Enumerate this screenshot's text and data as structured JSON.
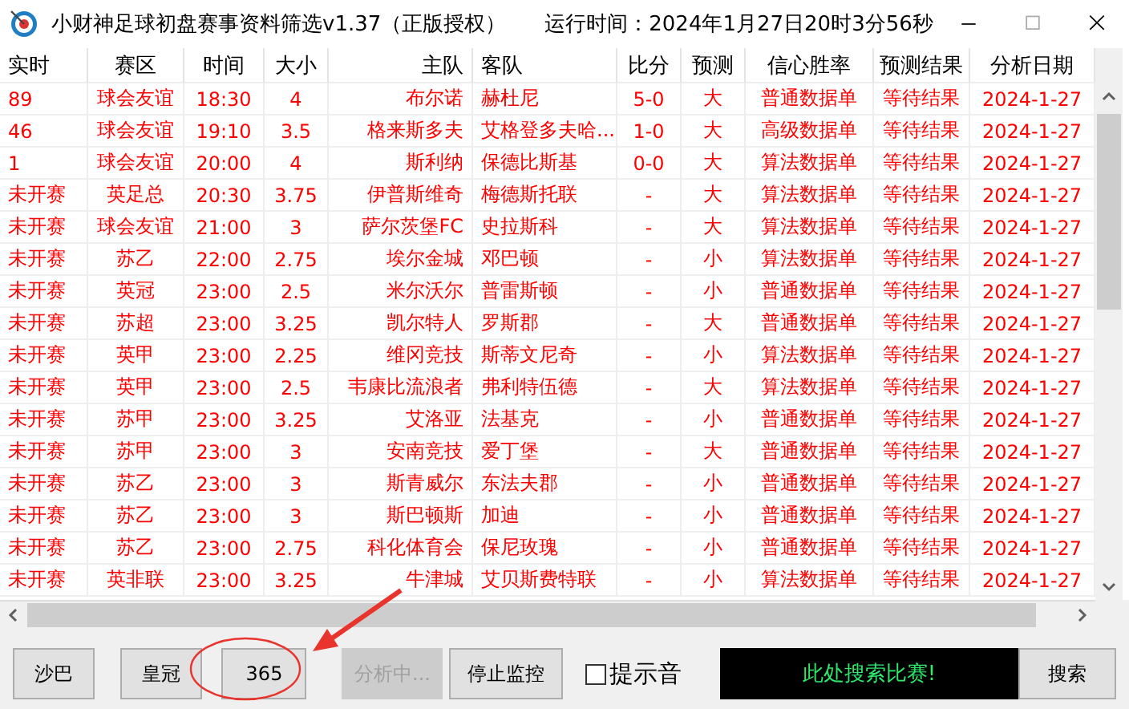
{
  "window": {
    "title": "小财神足球初盘赛事资料筛选v1.37（正版授权）",
    "run_time": "运行时间：2024年1月27日20时3分56秒"
  },
  "table": {
    "columns": [
      "实时",
      "赛区",
      "时间",
      "大小",
      "主队",
      "客队",
      "比分",
      "预测",
      "信心胜率",
      "预测结果",
      "分析日期"
    ],
    "rows": [
      [
        "89",
        "球会友谊",
        "18:30",
        "4",
        "布尔诺",
        "赫杜尼",
        "5-0",
        "大",
        "普通数据单",
        "等待结果",
        "2024-1-27"
      ],
      [
        "46",
        "球会友谊",
        "19:10",
        "3.5",
        "格来斯多夫",
        "艾格登多夫哈...",
        "1-0",
        "大",
        "高级数据单",
        "等待结果",
        "2024-1-27"
      ],
      [
        "1",
        "球会友谊",
        "20:00",
        "4",
        "斯利纳",
        "保德比斯基",
        "0-0",
        "大",
        "算法数据单",
        "等待结果",
        "2024-1-27"
      ],
      [
        "未开赛",
        "英足总",
        "20:30",
        "3.75",
        "伊普斯维奇",
        "梅德斯托联",
        "-",
        "大",
        "算法数据单",
        "等待结果",
        "2024-1-27"
      ],
      [
        "未开赛",
        "球会友谊",
        "21:00",
        "3",
        "萨尔茨堡FC",
        "史拉斯科",
        "-",
        "大",
        "算法数据单",
        "等待结果",
        "2024-1-27"
      ],
      [
        "未开赛",
        "苏乙",
        "22:00",
        "2.75",
        "埃尔金城",
        "邓巴顿",
        "-",
        "小",
        "算法数据单",
        "等待结果",
        "2024-1-27"
      ],
      [
        "未开赛",
        "英冠",
        "23:00",
        "2.5",
        "米尔沃尔",
        "普雷斯顿",
        "-",
        "小",
        "普通数据单",
        "等待结果",
        "2024-1-27"
      ],
      [
        "未开赛",
        "苏超",
        "23:00",
        "3.25",
        "凯尔特人",
        "罗斯郡",
        "-",
        "大",
        "普通数据单",
        "等待结果",
        "2024-1-27"
      ],
      [
        "未开赛",
        "英甲",
        "23:00",
        "2.25",
        "维冈竞技",
        "斯蒂文尼奇",
        "-",
        "小",
        "算法数据单",
        "等待结果",
        "2024-1-27"
      ],
      [
        "未开赛",
        "英甲",
        "23:00",
        "2.5",
        "韦康比流浪者",
        "弗利特伍德",
        "-",
        "大",
        "算法数据单",
        "等待结果",
        "2024-1-27"
      ],
      [
        "未开赛",
        "苏甲",
        "23:00",
        "3.25",
        "艾洛亚",
        "法基克",
        "-",
        "小",
        "普通数据单",
        "等待结果",
        "2024-1-27"
      ],
      [
        "未开赛",
        "苏甲",
        "23:00",
        "3",
        "安南竞技",
        "爱丁堡",
        "-",
        "大",
        "普通数据单",
        "等待结果",
        "2024-1-27"
      ],
      [
        "未开赛",
        "苏乙",
        "23:00",
        "3",
        "斯青威尔",
        "东法夫郡",
        "-",
        "小",
        "普通数据单",
        "等待结果",
        "2024-1-27"
      ],
      [
        "未开赛",
        "苏乙",
        "23:00",
        "3",
        "斯巴顿斯",
        "加迪",
        "-",
        "小",
        "普通数据单",
        "等待结果",
        "2024-1-27"
      ],
      [
        "未开赛",
        "苏乙",
        "23:00",
        "2.75",
        "科化体育会",
        "保尼玫瑰",
        "-",
        "小",
        "普通数据单",
        "等待结果",
        "2024-1-27"
      ],
      [
        "未开赛",
        "英非联",
        "23:00",
        "3.25",
        "牛津城",
        "艾贝斯费特联",
        "-",
        "小",
        "算法数据单",
        "等待结果",
        "2024-1-27"
      ]
    ]
  },
  "toolbar": {
    "buttons": [
      {
        "label": "沙巴",
        "disabled": false
      },
      {
        "label": "皇冠",
        "disabled": false
      },
      {
        "label": "365",
        "disabled": false
      },
      {
        "label": "分析中...",
        "disabled": true
      },
      {
        "label": "停止监控",
        "disabled": false
      }
    ],
    "sound_checkbox": {
      "label": "提示音",
      "checked": false
    },
    "search_banner": "此处搜索比赛!",
    "search_button": "搜索"
  }
}
